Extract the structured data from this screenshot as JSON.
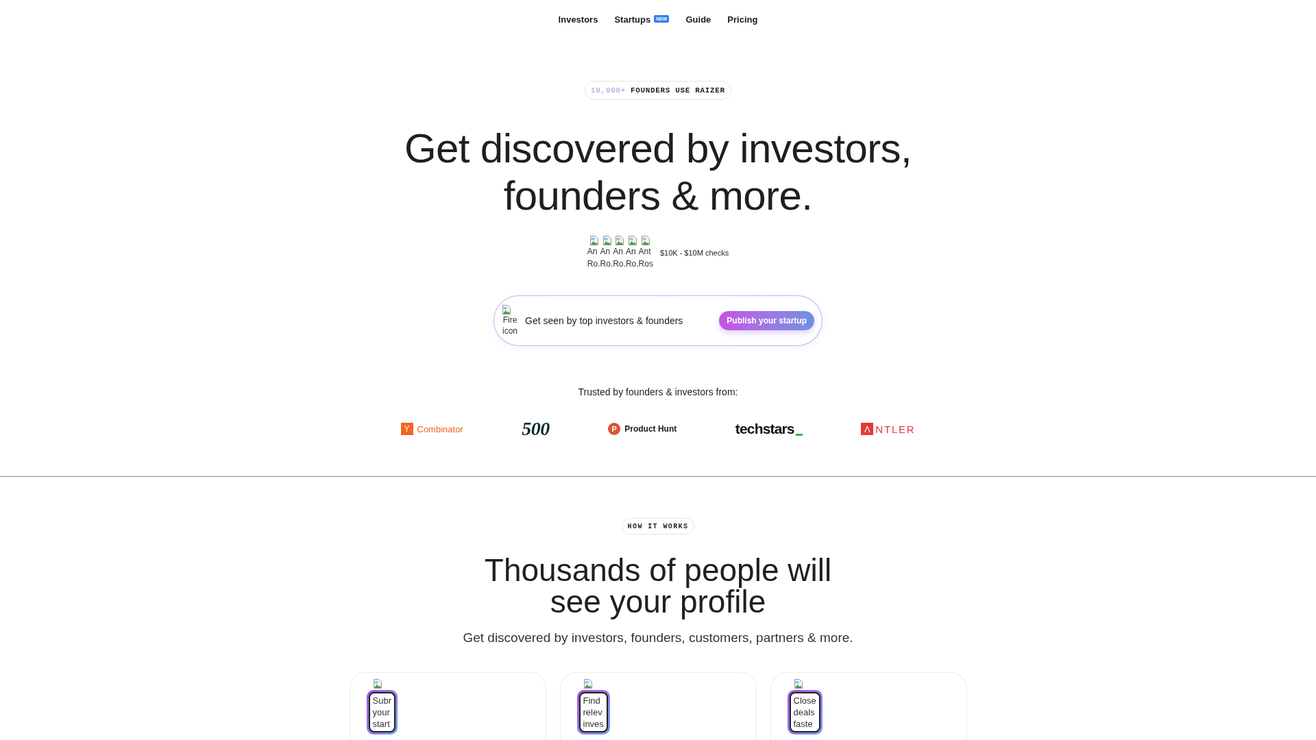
{
  "nav": {
    "items": [
      {
        "label": "Investors"
      },
      {
        "label": "Startups",
        "badge": "NEW"
      },
      {
        "label": "Guide"
      },
      {
        "label": "Pricing"
      }
    ]
  },
  "hero": {
    "badge": {
      "count": "10,000+",
      "text": "FOUNDERS USE RAIZER"
    },
    "heading_lines": [
      "Get discovered by investors,",
      "founders & more."
    ],
    "avatars": [
      {
        "alt_lines": [
          "An",
          "Ro."
        ]
      },
      {
        "alt_lines": [
          "An",
          "Ro."
        ]
      },
      {
        "alt_lines": [
          "An",
          "Ro."
        ]
      },
      {
        "alt_lines": [
          "An",
          "Ro."
        ]
      },
      {
        "alt_lines": [
          "Ant",
          "Ros"
        ]
      }
    ],
    "checks": "$10K - $10M checks"
  },
  "cta": {
    "icon_alt_lines": [
      "Fire",
      "icon"
    ],
    "text": "Get seen by top investors & founders",
    "button": "Publish your startup"
  },
  "trusted": {
    "label": "Trusted by founders & investors from:",
    "logos": [
      {
        "kind": "square_mark",
        "mark": "Y",
        "text": "Combinator",
        "color": "#f26522"
      },
      {
        "kind": "serif",
        "text": "500",
        "color": "#0f2b2b"
      },
      {
        "kind": "circle_mark",
        "mark": "P",
        "text": "Product Hunt",
        "color": "#da552f"
      },
      {
        "kind": "wordmark",
        "text": "techstars",
        "color": "#3bb54a"
      },
      {
        "kind": "letter_box",
        "mark": "Λ",
        "text": "NTLER",
        "color": "#e5383b"
      }
    ]
  },
  "how_it_works": {
    "badge": "HOW IT WORKS",
    "heading_lines": [
      "Thousands of people will",
      "see your profile"
    ],
    "subtitle": "Get discovered by investors, founders, customers, partners & more.",
    "cards": [
      {
        "icon_alt_lines": [
          "Subr",
          "your",
          "start"
        ]
      },
      {
        "icon_alt_lines": [
          "Find",
          "relev",
          "inves"
        ]
      },
      {
        "icon_alt_lines": [
          "Close",
          "deals",
          "faste"
        ]
      }
    ]
  }
}
